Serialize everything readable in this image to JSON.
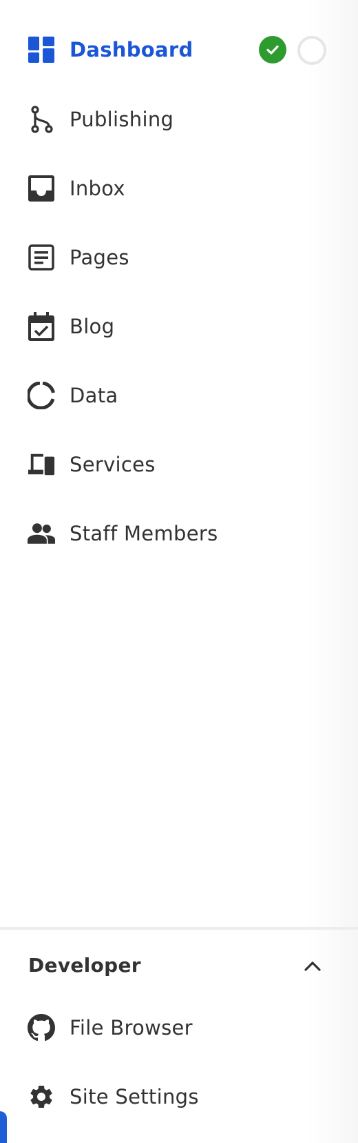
{
  "nav": {
    "dashboard": {
      "label": "Dashboard",
      "icon": "dashboard-icon"
    },
    "publishing": {
      "label": "Publishing",
      "icon": "branch-icon"
    },
    "inbox": {
      "label": "Inbox",
      "icon": "inbox-icon"
    },
    "pages": {
      "label": "Pages",
      "icon": "page-icon"
    },
    "blog": {
      "label": "Blog",
      "icon": "calendar-check-icon"
    },
    "data": {
      "label": "Data",
      "icon": "donut-chart-icon"
    },
    "services": {
      "label": "Services",
      "icon": "devices-icon"
    },
    "staff": {
      "label": "Staff Members",
      "icon": "people-icon"
    }
  },
  "dashboard_status": {
    "check_icon": "check-circle-icon",
    "empty_icon": "empty-circle-icon"
  },
  "developer": {
    "title": "Developer",
    "expanded": true,
    "items": {
      "file_browser": {
        "label": "File Browser",
        "icon": "github-icon"
      },
      "site_settings": {
        "label": "Site Settings",
        "icon": "gear-icon"
      }
    }
  },
  "colors": {
    "accent": "#1a56d6",
    "success": "#2e9b2f",
    "text": "#333333"
  }
}
